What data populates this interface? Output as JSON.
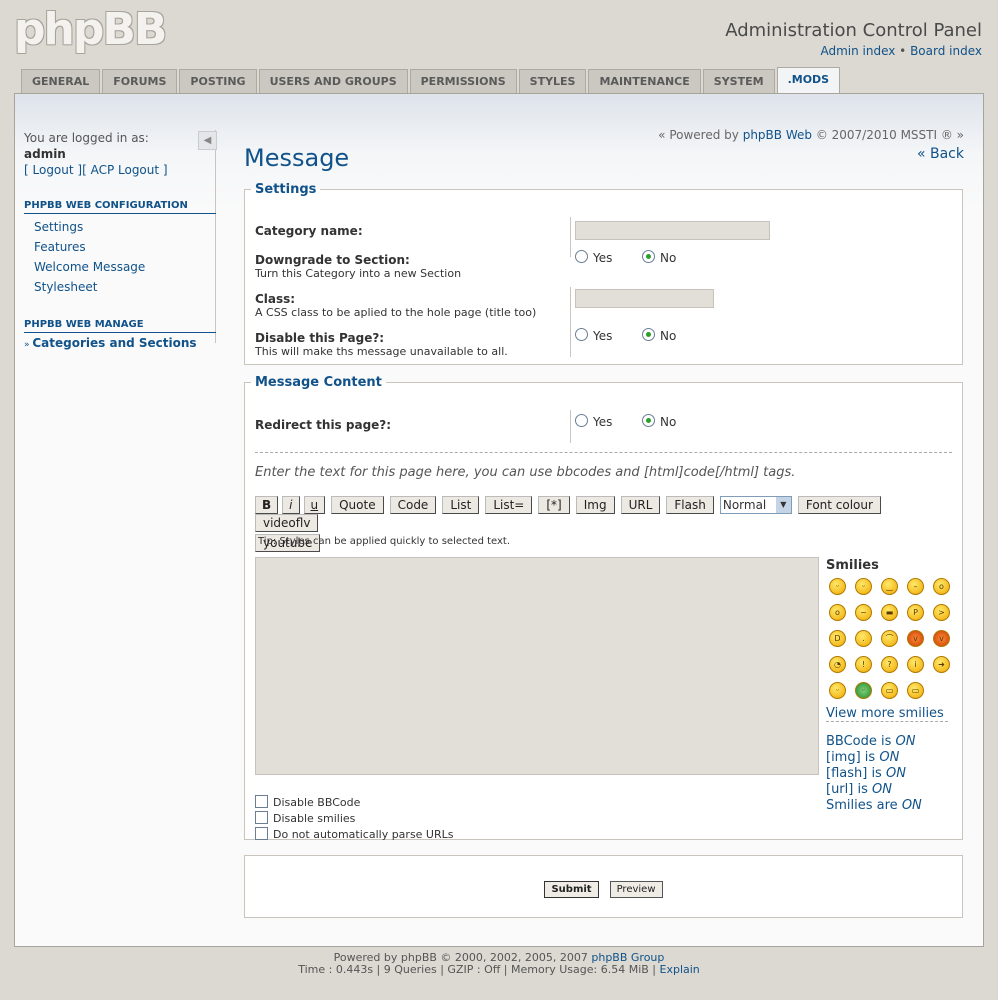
{
  "logo": "phpBB",
  "header": {
    "title": "Administration Control Panel",
    "admin_index": "Admin index",
    "sep": "•",
    "board_index": "Board index"
  },
  "tabs": [
    "GENERAL",
    "FORUMS",
    "POSTING",
    "USERS AND GROUPS",
    "PERMISSIONS",
    "STYLES",
    "MAINTENANCE",
    "SYSTEM",
    ".MODS"
  ],
  "active_tab": ".MODS",
  "sidebar": {
    "logged_in": "You are logged in as:",
    "user": "admin",
    "logout": "[ Logout ][ ACP Logout ]",
    "config_head": "PHPBB WEB CONFIGURATION",
    "config_items": [
      "Settings",
      "Features",
      "Welcome Message",
      "Stylesheet"
    ],
    "manage_head": "PHPBB WEB MANAGE",
    "manage_items": [
      "Categories and Sections"
    ]
  },
  "powered": {
    "prefix": "« Powered by",
    "link": "phpBB Web",
    "suffix": "© 2007/2010 MSSTI ® »"
  },
  "back": "« Back",
  "page_title": "Message",
  "settings": {
    "legend": "Settings",
    "category_name": "Category name:",
    "downgrade": "Downgrade to Section:",
    "downgrade_sub": "Turn this Category into a new Section",
    "class": "Class:",
    "class_sub": "A CSS class to be aplied to the hole page (title too)",
    "disable": "Disable this Page?:",
    "disable_sub": "This will make ths message unavailable to all.",
    "yes": "Yes",
    "no": "No"
  },
  "content": {
    "legend": "Message Content",
    "redirect": "Redirect this page?:",
    "hint": "Enter the text for this page here, you can use bbcodes and [html]code[/html] tags.",
    "buttons": [
      "B",
      "i",
      "u",
      "Quote",
      "Code",
      "List",
      "List=",
      "[*]",
      "Img",
      "URL",
      "Flash"
    ],
    "size_select": "Normal",
    "buttons2": [
      "Font colour",
      "videoflv"
    ],
    "youtube": "youtube",
    "tip": "Tip: Styles can be applied quickly to selected text.",
    "smilies_title": "Smilies",
    "view_more": "View more smilies",
    "status": [
      {
        "label": "BBCode is",
        "value": "ON"
      },
      {
        "label": "[img] is",
        "value": "ON"
      },
      {
        "label": "[flash] is",
        "value": "ON"
      },
      {
        "label": "[url] is",
        "value": "ON"
      },
      {
        "label": "Smilies are",
        "value": "ON"
      }
    ],
    "options": [
      "Disable BBCode",
      "Disable smilies",
      "Do not automatically parse URLs"
    ]
  },
  "actions": {
    "submit": "Submit",
    "preview": "Preview"
  },
  "footer": {
    "line1_prefix": "Powered by phpBB © 2000, 2002, 2005, 2007",
    "line1_link": "phpBB Group",
    "line2_prefix": "Time : 0.443s | 9 Queries | GZIP : Off | Memory Usage: 6.54 MiB |",
    "line2_link": "Explain"
  }
}
